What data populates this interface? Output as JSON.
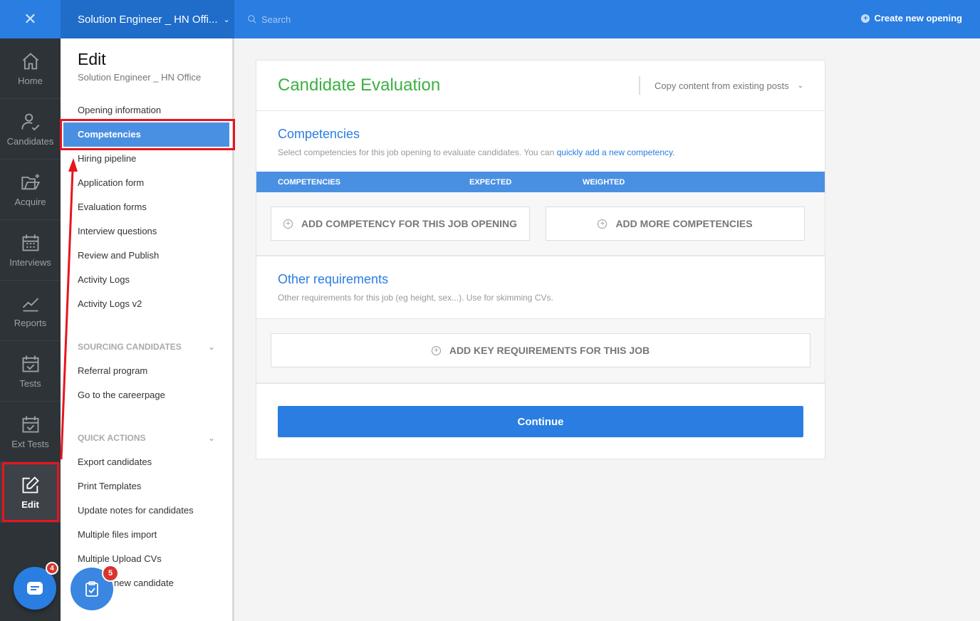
{
  "topbar": {
    "job_title": "Solution Engineer _ HN Offi...",
    "search_placeholder": "Search",
    "create_label": "Create new opening"
  },
  "rail": {
    "items": [
      {
        "label": "Home",
        "icon": "home-icon"
      },
      {
        "label": "Candidates",
        "icon": "user-check-icon"
      },
      {
        "label": "Acquire",
        "icon": "folder-plus-icon"
      },
      {
        "label": "Interviews",
        "icon": "calendar-grid-icon"
      },
      {
        "label": "Reports",
        "icon": "line-chart-icon"
      },
      {
        "label": "Tests",
        "icon": "calendar-check-icon"
      },
      {
        "label": "Ext Tests",
        "icon": "calendar-check-icon"
      },
      {
        "label": "Edit",
        "icon": "edit-icon"
      }
    ],
    "chat_badge": "4"
  },
  "sidenav": {
    "title": "Edit",
    "subtitle": "Solution Engineer _ HN Office",
    "items": [
      "Opening information",
      "Competencies",
      "Hiring pipeline",
      "Application form",
      "Evaluation forms",
      "Interview questions",
      "Review and Publish",
      "Activity Logs",
      "Activity Logs v2"
    ],
    "sourcing_head": "SOURCING CANDIDATES",
    "sourcing_items": [
      "Referral program",
      "Go to the careerpage"
    ],
    "quick_head": "QUICK ACTIONS",
    "quick_items": [
      "Export candidates",
      "Print Templates",
      "Update notes for candidates",
      "Multiple files import",
      "Multiple Upload CVs",
      "new candidate"
    ],
    "tasks_badge": "5"
  },
  "card": {
    "title": "Candidate Evaluation",
    "copy_label": "Copy content from existing posts",
    "competencies": {
      "heading": "Competencies",
      "desc": "Select competencies for this job opening to evaluate candidates. You can",
      "link": "quickly add a new competency."
    },
    "table_headers": [
      "COMPETENCIES",
      "EXPECTED",
      "WEIGHTED"
    ],
    "add_competency": "ADD COMPETENCY FOR THIS JOB OPENING",
    "add_more": "ADD MORE COMPETENCIES",
    "other": {
      "heading": "Other requirements",
      "desc": "Other requirements for this job (eg height, sex...). Use for skimming CVs."
    },
    "add_key": "ADD KEY REQUIREMENTS FOR THIS JOB",
    "continue": "Continue"
  },
  "colors": {
    "primary": "#2a7de1",
    "green": "#3bb040",
    "rail": "#2e3338",
    "highlight": "#e8141e"
  }
}
